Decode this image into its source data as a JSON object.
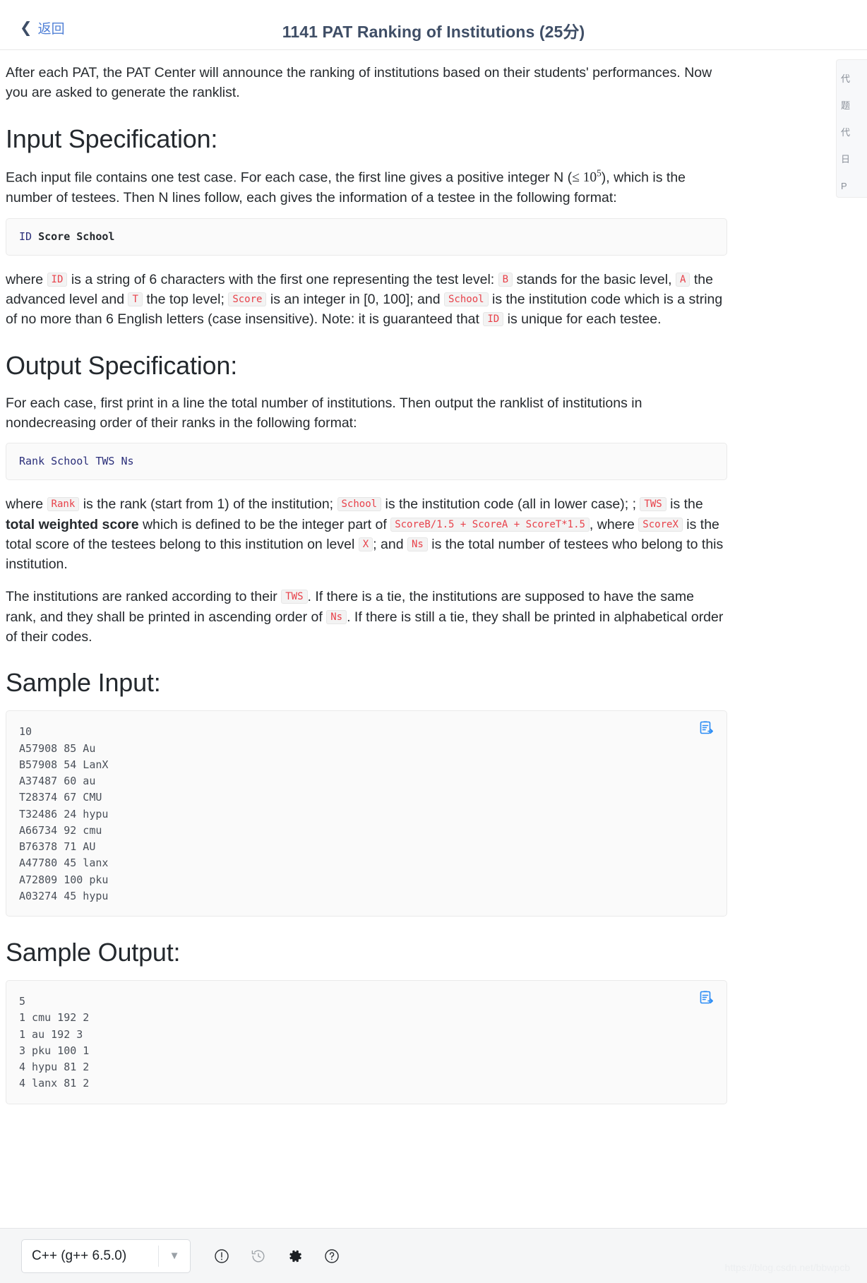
{
  "header": {
    "back_label": "返回",
    "back_chevron": "chevron-left-icon",
    "title": "1141 PAT Ranking of Institutions (25分)"
  },
  "right_rail": {
    "items": [
      "代",
      "题",
      "代",
      "日",
      "P"
    ]
  },
  "body": {
    "intro": "After each PAT, the PAT Center will announce the ranking of institutions based on their students' performances. Now you are asked to generate the ranklist.",
    "input_spec": {
      "heading": "Input Specification:",
      "para_1a": "Each input file contains one test case. For each case, the first line gives a positive integer N (",
      "para_1_math": "≤ 10",
      "para_1_math_sup": "5",
      "para_1b": "), which is the number of testees. Then N lines follow, each gives the information of a testee in the following format:",
      "code_block": {
        "tok_id": "ID",
        "tok_score": "Score",
        "tok_school": "School"
      },
      "where_1": "where",
      "badge_id": "ID",
      "where_2": "is a string of 6 characters with the first one representing the test level:",
      "badge_b": "B",
      "where_3": "stands for the basic level,",
      "badge_a": "A",
      "where_4": "the advanced level and",
      "badge_t": "T",
      "where_5": "the top level;",
      "badge_score": "Score",
      "where_6": "is an integer in [0, 100]; and",
      "badge_school": "School",
      "where_7": "is the institution code which is a string of no more than 6 English letters (case insensitive). Note: it is guaranteed that",
      "badge_id2": "ID",
      "where_8": "is unique for each testee."
    },
    "output_spec": {
      "heading": "Output Specification:",
      "para_1": "For each case, first print in a line the total number of institutions. Then output the ranklist of institutions in nondecreasing order of their ranks in the following format:",
      "code_block": "Rank School TWS Ns",
      "where_1": "where",
      "badge_rank": "Rank",
      "where_2": "is the rank (start from 1) of the institution;",
      "badge_school": "School",
      "where_3": "is the institution code (all in lower case); ;",
      "badge_tws": "TWS",
      "where_4": "is the",
      "bold_tws": "total weighted score",
      "where_5": "which is defined to be the integer part of",
      "badge_formula": "ScoreB/1.5 + ScoreA + ScoreT*1.5",
      "where_6": ", where",
      "badge_scorex": "ScoreX",
      "where_7": "is the total score of the testees belong to this institution on level",
      "badge_x": "X",
      "where_8": "; and",
      "badge_ns": "Ns",
      "where_9": "is the total number of testees who belong to this institution.",
      "para_rank_1": "The institutions are ranked according to their",
      "badge_tws2": "TWS",
      "para_rank_2": ". If there is a tie, the institutions are supposed to have the same rank, and they shall be printed in ascending order of",
      "badge_ns2": "Ns",
      "para_rank_3": ". If there is still a tie, they shall be printed in alphabetical order of their codes."
    },
    "sample_input": {
      "heading": "Sample Input:",
      "lines": [
        "10",
        "A57908 85 Au",
        "B57908 54 LanX",
        "A37487 60 au",
        "T28374 67 CMU",
        "T32486 24 hypu",
        "A66734 92 cmu",
        "B76378 71 AU",
        "A47780 45 lanx",
        "A72809 100 pku",
        "A03274 45 hypu"
      ],
      "copy_icon": "copy-to-clipboard-icon"
    },
    "sample_output": {
      "heading": "Sample Output:",
      "lines": [
        "5",
        "1 cmu 192 2",
        "1 au 192 3",
        "3 pku 100 1",
        "4 hypu 81 2",
        "4 lanx 81 2"
      ],
      "copy_icon": "copy-to-clipboard-icon"
    }
  },
  "bottom_bar": {
    "language": "C++ (g++ 6.5.0)",
    "dropdown_icon": "chevron-down-icon",
    "icons": [
      {
        "name": "exclamation-circle-icon"
      },
      {
        "name": "history-clock-icon"
      },
      {
        "name": "gear-icon"
      },
      {
        "name": "question-circle-icon"
      }
    ],
    "watermark": "https://blog.csdn.net/bbwpcb"
  },
  "colors": {
    "accent_blue": "#4f7fd6",
    "title_blue": "#3f4e66",
    "code_red": "#e8414a",
    "code_navy": "#2b2f7a",
    "copy_blue": "#2a8cf5"
  }
}
